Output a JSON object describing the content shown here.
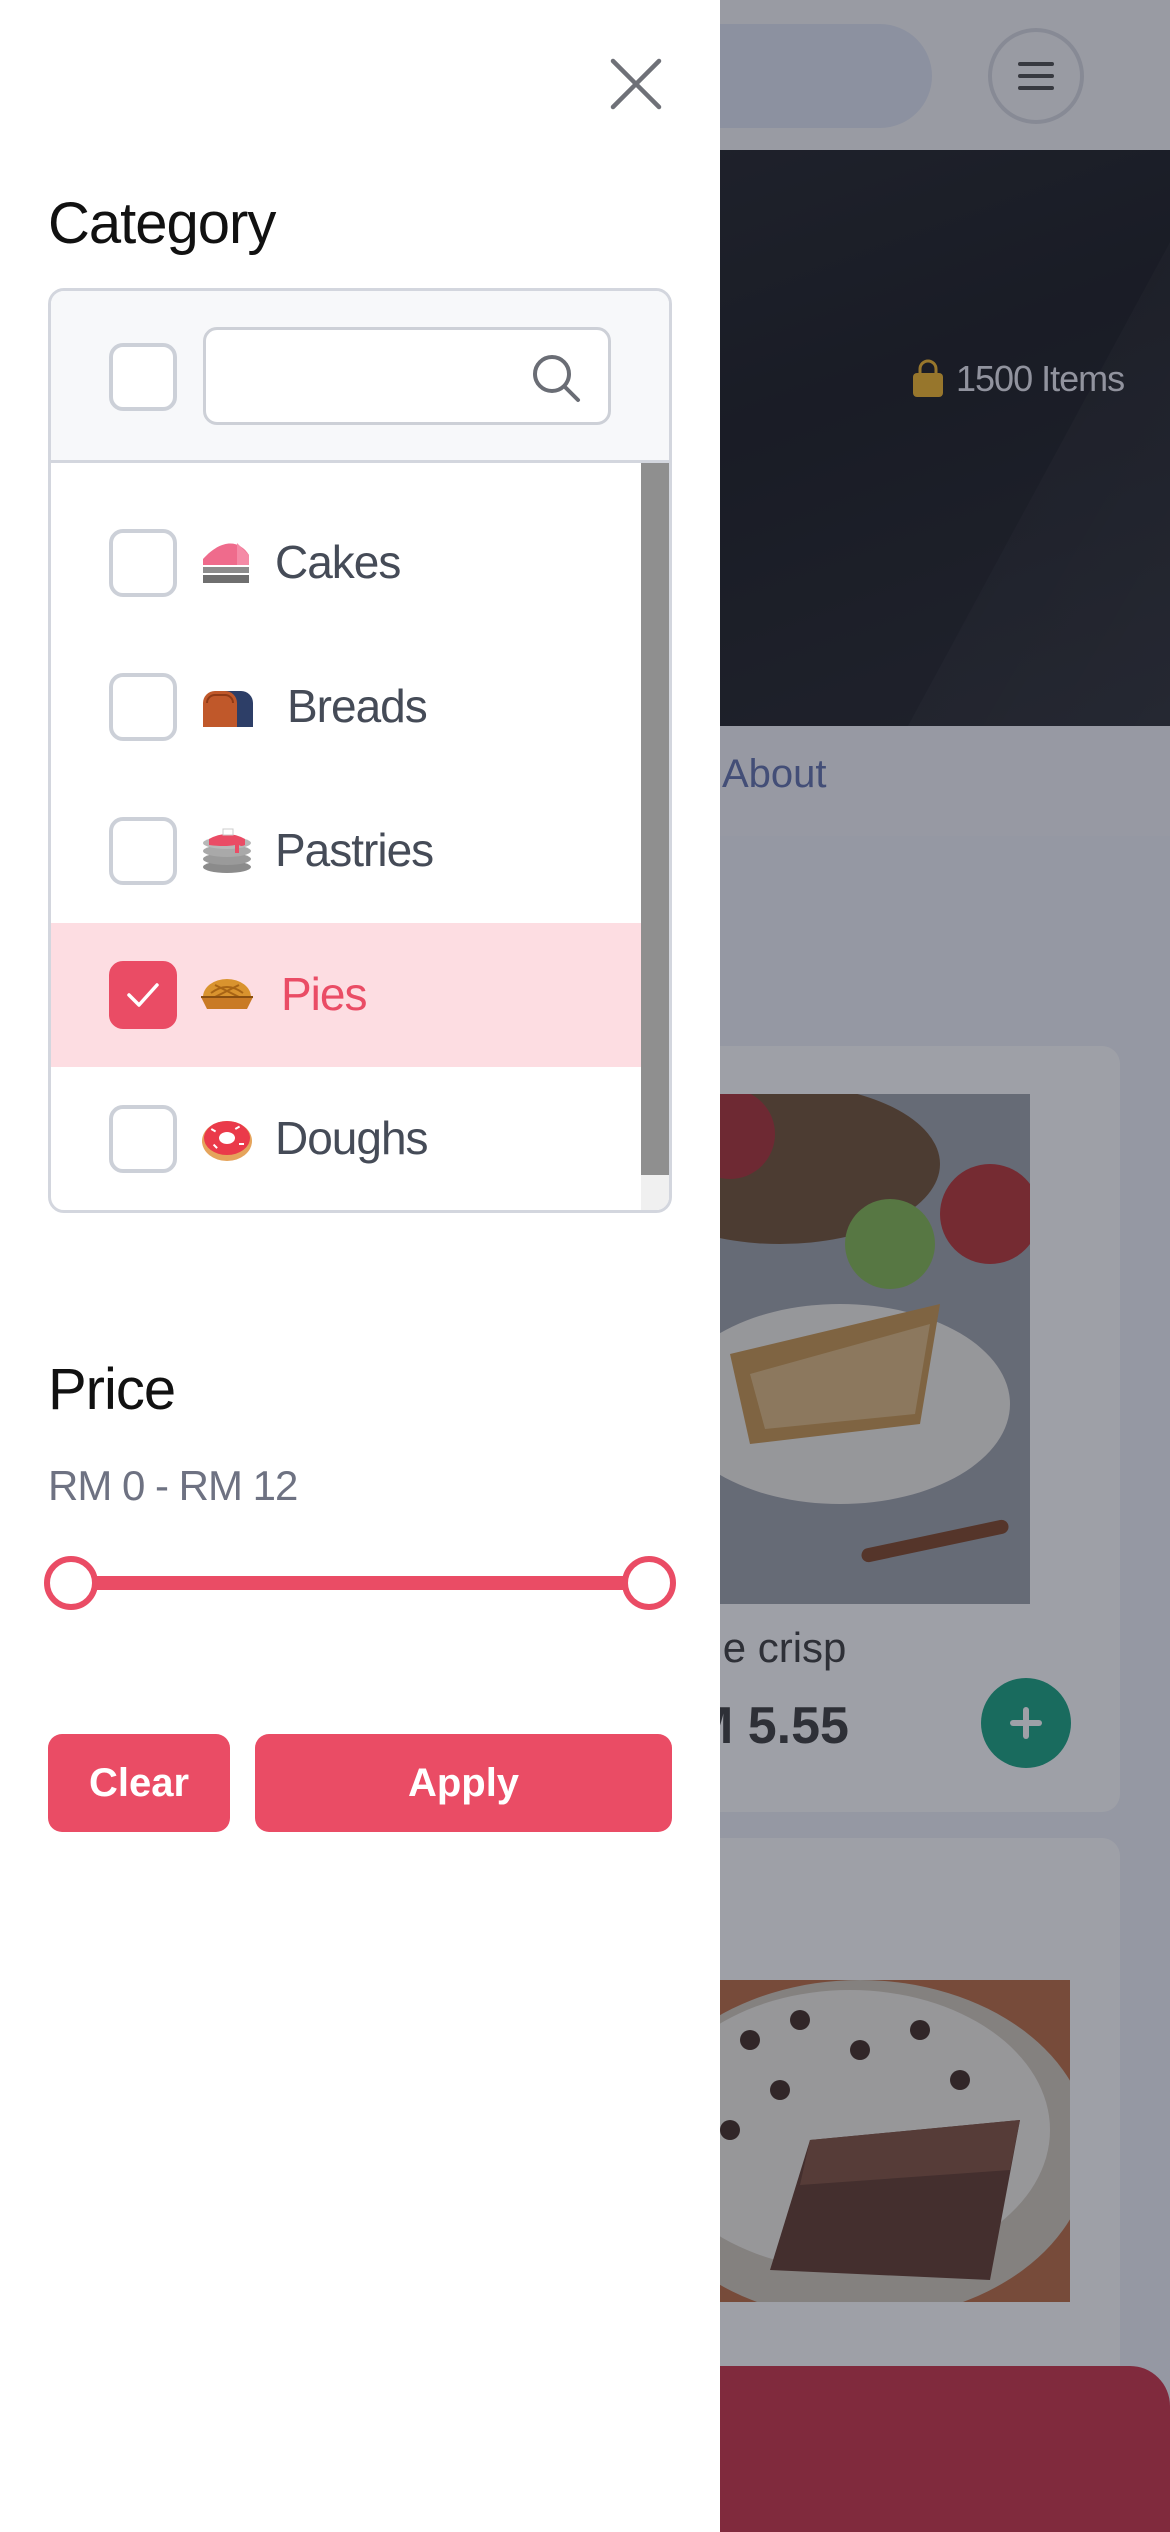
{
  "background": {
    "hero_items": "1500 Items",
    "tab_about": "About",
    "product": {
      "name": "ple crisp",
      "price": "M 5.55"
    }
  },
  "drawer": {
    "category_title": "Category",
    "search": {
      "value": "",
      "placeholder": ""
    },
    "categories": [
      {
        "label": "Cakes",
        "icon": "cake-icon",
        "checked": false
      },
      {
        "label": "Breads",
        "icon": "bread-icon",
        "checked": false
      },
      {
        "label": "Pastries",
        "icon": "pancake-icon",
        "checked": false
      },
      {
        "label": "Pies",
        "icon": "pie-icon",
        "checked": true
      },
      {
        "label": "Doughs",
        "icon": "donut-icon",
        "checked": false
      }
    ],
    "price_title": "Price",
    "price_range": "RM 0 - RM 12",
    "price_min": 0,
    "price_max": 12,
    "clear_label": "Clear",
    "apply_label": "Apply"
  },
  "colors": {
    "accent": "#ea4c65",
    "selected_bg": "#fddde2",
    "add_button": "#0e9f7a"
  }
}
